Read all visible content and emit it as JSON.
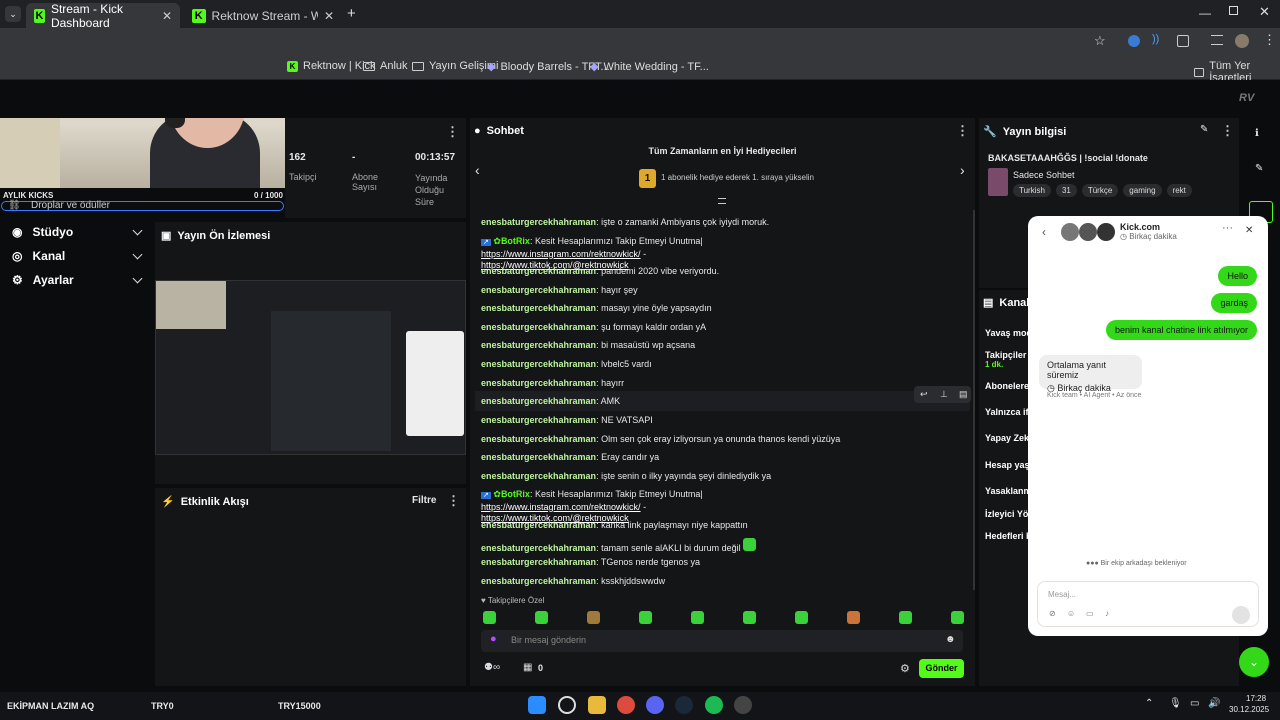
{
  "browser": {
    "tabs": [
      {
        "title": "Stream - Kick Dashboard"
      },
      {
        "title": "Rektnow Stream - Watch Live o"
      }
    ],
    "bookmarks": [
      {
        "label": "Rektnow | Kick"
      },
      {
        "label": "Anluk"
      },
      {
        "label": "Yayın Gelişimi"
      },
      {
        "label": "Bloody Barrels - TFT..."
      },
      {
        "label": "White Wedding - TF..."
      },
      {
        "label": "Tüm Yer İşaretleri"
      }
    ]
  },
  "overlay": {
    "title": "AYLIK KICKS",
    "progress": "0 / 1000",
    "progress_fraction": 0,
    "bar_label": "Droplar ve ödüller"
  },
  "sidebar": {
    "items": [
      {
        "label": "Stüdyo"
      },
      {
        "label": "Kanal"
      },
      {
        "label": "Ayarlar"
      }
    ]
  },
  "stats": {
    "items": [
      {
        "value": "162",
        "label": "Takipçi"
      },
      {
        "value": "-",
        "label": "Abone Sayısı"
      },
      {
        "value": "00:13:57",
        "label": "Yayında Olduğu Süre"
      }
    ]
  },
  "preview": {
    "title": "Yayın Ön İzlemesi"
  },
  "activity": {
    "title": "Etkinlik Akışı",
    "filter": "Filtre"
  },
  "chat": {
    "title": "Sohbet",
    "gifters_title": "Tüm Zamanların en İyi Hediyecileri",
    "rank": "1",
    "gifters_sub": "1 abonelik hediye ederek 1. sıraya yükselin",
    "messages": [
      {
        "user": "enesbaturgercekhahraman",
        "text": "işte o zamanki Ambiyans çok iyiydi moruk."
      },
      {
        "user": "BotRix",
        "text": "Kesit Hesaplarımızı Takip Etmeyi Unutma|",
        "link1": "https://www.instagram.com/rektnowkick/",
        "sep": " -",
        "link2": "https://www.tiktok.com/@rektnowkick"
      },
      {
        "user": "enesbaturgercekhahraman",
        "text": "pandemi 2020 vibe veriyordu."
      },
      {
        "user": "enesbaturgercekhahraman",
        "text": "hayır şey"
      },
      {
        "user": "enesbaturgercekhahraman",
        "text": "masayı yine öyle yapsaydın"
      },
      {
        "user": "enesbaturgercekhahraman",
        "text": "şu formayı kaldır ordan yA"
      },
      {
        "user": "enesbaturgercekhahraman",
        "text": "bi masaüstü wp açsana"
      },
      {
        "user": "enesbaturgercekhahraman",
        "text": "lvbelc5 vardı"
      },
      {
        "user": "enesbaturgercekhahraman",
        "text": "hayırr"
      },
      {
        "user": "enesbaturgercekhahraman",
        "text": "AMK"
      },
      {
        "user": "enesbaturgercekhahraman",
        "text": "NE VATSAPI"
      },
      {
        "user": "enesbaturgercekhahraman",
        "text": "Olm sen çok eray izliyorsun ya onunda thanos kendi yüzüya"
      },
      {
        "user": "enesbaturgercekhahraman",
        "text": "Eray candır ya"
      },
      {
        "user": "enesbaturgercekhahraman",
        "text": "işte senin o ilky yayında şeyi dinlediydik ya"
      },
      {
        "user": "BotRix",
        "text": "Kesit Hesaplarımızı Takip Etmeyi Unutma|",
        "link1": "https://www.instagram.com/rektnowkick/",
        "sep": " -",
        "link2": "https://www.tiktok.com/@rektnowkick"
      },
      {
        "user": "enesbaturgercekhahraman",
        "text": "kanka link paylaşmayı niye kappattın"
      },
      {
        "user": "enesbaturgercekhahraman",
        "text": "tamam senle alAKLI bi durum değil"
      },
      {
        "user": "enesbaturgercekhahraman",
        "text": "TGenos nerde tgenos ya"
      },
      {
        "user": "enesbaturgercekhahraman",
        "text": "ksskhjddswwdw"
      }
    ],
    "followers_label": "Takipçilere Özel",
    "input_placeholder": "Bir mesaj gönderin",
    "count": "0",
    "send": "Gönder"
  },
  "info": {
    "title": "Yayın bilgisi",
    "stream_title": "BAKASETAAAHĞĞS | !social !donate",
    "category": "Sadece Sohbet",
    "tags": [
      "Turkish",
      "31",
      "Türkçe",
      "gaming",
      "rekt"
    ]
  },
  "settings": {
    "title": "Kanal E",
    "rows": [
      "Yavaş mod",
      "Takipçiler",
      "1 dk.",
      "Abonelere",
      "Yalnızca if",
      "Yapay Zek",
      "Hesap yaşı",
      "Yasaklanm",
      "İzleyici Yö",
      "Hedefleri b"
    ]
  },
  "popup": {
    "title": "Kick.com",
    "sub": "Birkaç dakika",
    "bubbles": [
      "Hello",
      "gardaş",
      "benim kanal chatine link atılmıyor"
    ],
    "reply_line1": "Ortalama yanıt süremiz",
    "reply_line2": "Birkaç dakika",
    "reply_meta": "Kick team • AI Agent • Az önce",
    "waiting": "Bir ekip arkadaşı bekleniyor",
    "input_placeholder": "Mesaj..."
  },
  "taskbar": {
    "left": [
      "EKİPMAN LAZIM AQ",
      "TRY0",
      "TRY15000"
    ],
    "time": "17:28",
    "date": "30.12.2025"
  }
}
